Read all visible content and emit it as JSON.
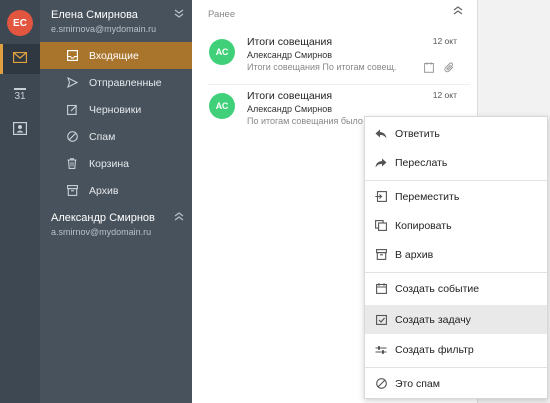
{
  "rail": {
    "avatar_initials": "ЕС",
    "calendar_day": "31"
  },
  "accounts": [
    {
      "name": "Елена Смирнова",
      "email": "e.smirnova@mydomain.ru",
      "folders": [
        {
          "label": "Входящие",
          "icon": "inbox-icon",
          "active": true
        },
        {
          "label": "Отправленные",
          "icon": "send-icon"
        },
        {
          "label": "Черновики",
          "icon": "draft-icon"
        },
        {
          "label": "Спам",
          "icon": "spam-icon"
        },
        {
          "label": "Корзина",
          "icon": "trash-icon"
        },
        {
          "label": "Архив",
          "icon": "archive-icon"
        }
      ]
    },
    {
      "name": "Александр Смирнов",
      "email": "a.smirnov@mydomain.ru"
    }
  ],
  "list": {
    "section": "Ранее",
    "messages": [
      {
        "initials": "АС",
        "subject": "Итоги совещания",
        "sender": "Александр Смирнов",
        "preview": "Итоги совещания По итогам совещ...",
        "date": "12 окт"
      },
      {
        "initials": "АС",
        "subject": "Итоги совещания",
        "sender": "Александр Смирнов",
        "preview": "По итогам совещания было",
        "date": "12 окт"
      }
    ]
  },
  "context_menu": {
    "items": [
      {
        "label": "Ответить",
        "icon": "reply-icon"
      },
      {
        "label": "Переслать",
        "icon": "forward-icon"
      },
      {
        "label": "Переместить",
        "icon": "move-icon"
      },
      {
        "label": "Копировать",
        "icon": "copy-icon"
      },
      {
        "label": "В архив",
        "icon": "archive-icon"
      },
      {
        "label": "Создать событие",
        "icon": "event-icon"
      },
      {
        "label": "Создать задачу",
        "icon": "task-icon"
      },
      {
        "label": "Создать фильтр",
        "icon": "filter-icon"
      },
      {
        "label": "Это спам",
        "icon": "spam-icon"
      }
    ]
  },
  "colors": {
    "accent": "#a9742c",
    "rail_accent": "#e0a040",
    "avatar_user": "#e2553f",
    "avatar_contact": "#40d07a",
    "sidebar": "#47525c"
  }
}
